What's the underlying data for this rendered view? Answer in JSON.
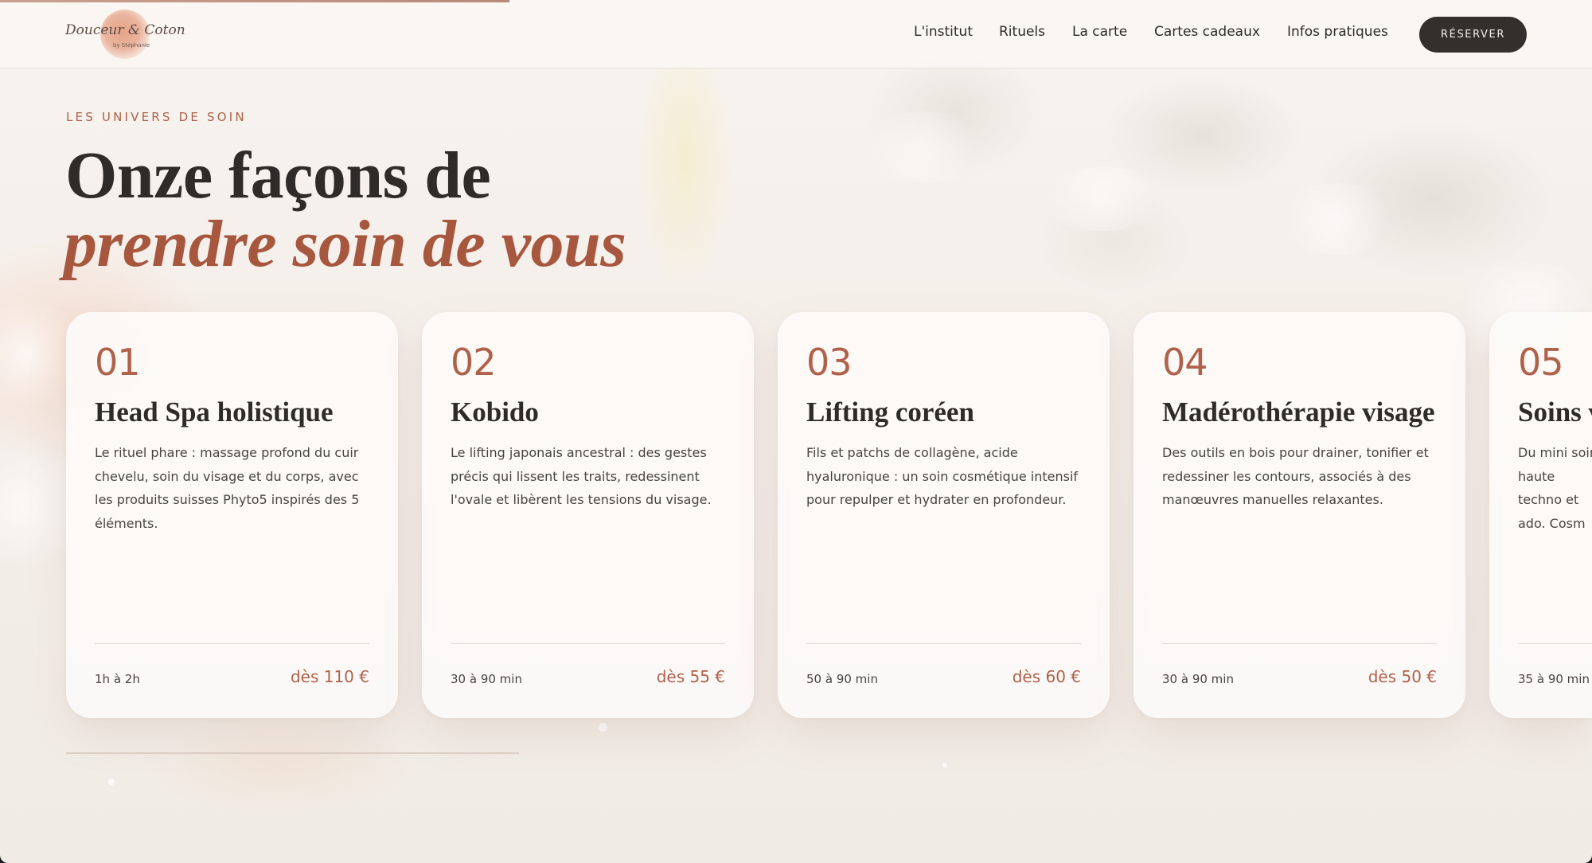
{
  "header": {
    "logo": {
      "text": "Douceur & Coton",
      "subtext": "by Stéphanie"
    },
    "nav": [
      {
        "label": "L'institut"
      },
      {
        "label": "Rituels"
      },
      {
        "label": "La carte"
      },
      {
        "label": "Cartes cadeaux"
      },
      {
        "label": "Infos pratiques"
      }
    ],
    "reserve_label": "RÉSERVER"
  },
  "hero": {
    "eyebrow": "LES UNIVERS DE SOIN",
    "title_line1": "Onze façons de",
    "title_line2": "prendre soin de vous"
  },
  "cards": [
    {
      "number": "01",
      "title": "Head Spa holistique",
      "description": "Le rituel phare : massage profond du cuir chevelu, soin du visage et du corps, avec les produits suisses Phyto5 inspirés des 5 éléments.",
      "duration": "1h à 2h",
      "price": "dès 110 €"
    },
    {
      "number": "02",
      "title": "Kobido",
      "description": "Le lifting japonais ancestral : des gestes précis qui lissent les traits, redessinent l'ovale et libèrent les tensions du visage.",
      "duration": "30 à 90 min",
      "price": "dès 55 €"
    },
    {
      "number": "03",
      "title": "Lifting coréen",
      "description": "Fils et patchs de collagène, acide hyaluronique : un soin cosmétique intensif pour repulper et hydrater en profondeur.",
      "duration": "50 à 90 min",
      "price": "dès 60 €"
    },
    {
      "number": "04",
      "title": "Madérothérapie visage",
      "description": "Des outils en bois pour drainer, tonifier et redessiner les contours, associés à des manœuvres manuelles relaxantes.",
      "duration": "30 à 90 min",
      "price": "dès 50 €"
    },
    {
      "number": "05",
      "title": "Soins v",
      "description": "Du mini soin haute techno et ado. Cosm",
      "duration": "35 à 90 min",
      "price": ""
    }
  ],
  "page_scroll_progress": 0.32,
  "carousel_scroll_progress": 0.31,
  "colors": {
    "accent": "#b0614a",
    "title_italic": "#a8573f",
    "text": "#2f2b29",
    "button_bg": "#332f2d",
    "button_text": "#f4ede7"
  }
}
